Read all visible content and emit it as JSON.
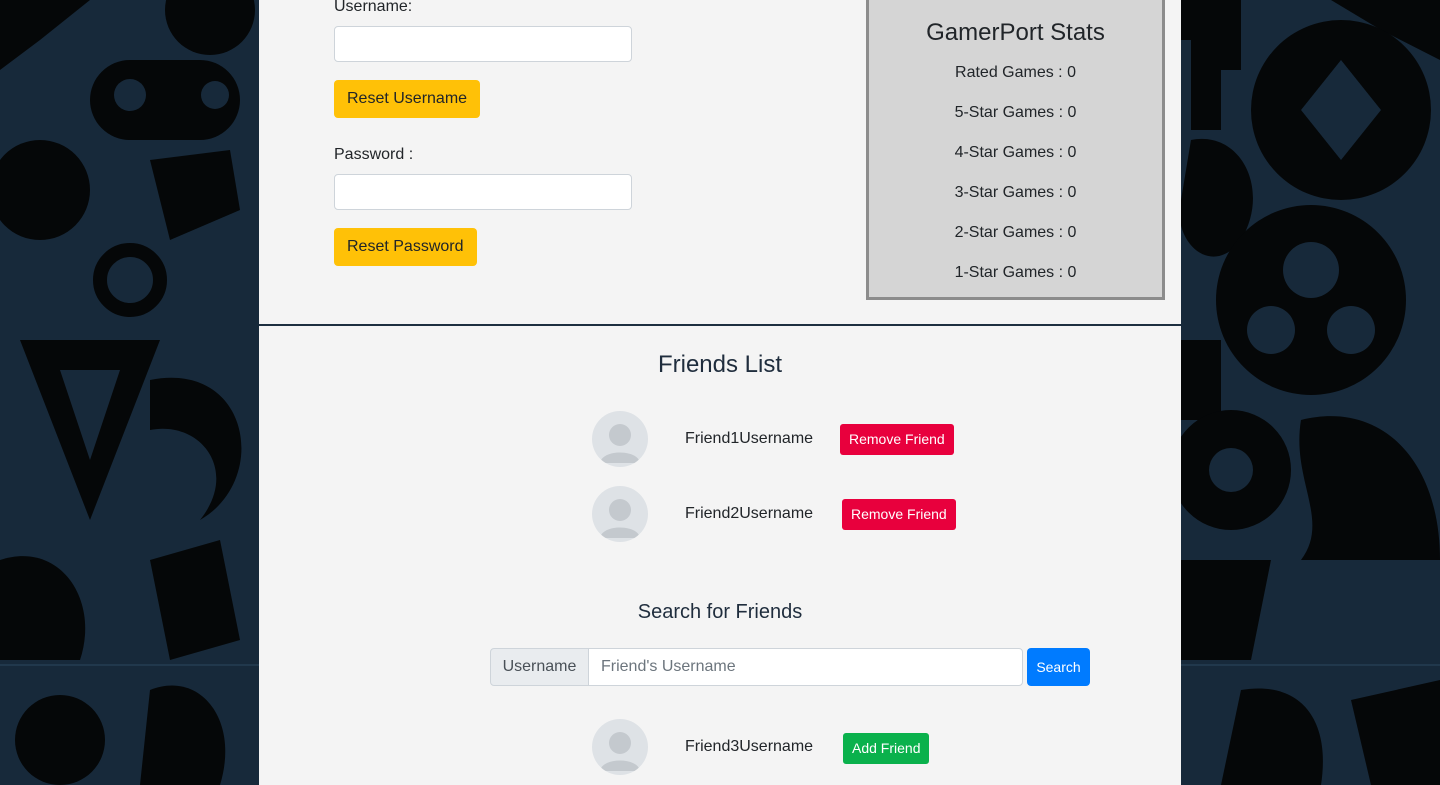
{
  "account": {
    "username_label": "Username:",
    "username_value": "",
    "reset_username_label": "Reset Username",
    "password_label": "Password :",
    "password_value": "",
    "reset_password_label": "Reset Password"
  },
  "stats": {
    "title": "GamerPort Stats",
    "lines": [
      "Rated Games : 0",
      "5-Star Games : 0",
      "4-Star Games : 0",
      "3-Star Games : 0",
      "2-Star Games : 0",
      "1-Star Games : 0"
    ]
  },
  "friends": {
    "title": "Friends List",
    "items": [
      {
        "name": "Friend1Username",
        "action": "Remove Friend"
      },
      {
        "name": "Friend2Username",
        "action": "Remove Friend"
      }
    ]
  },
  "search": {
    "title": "Search for Friends",
    "prefix": "Username",
    "placeholder": "Friend's Username",
    "button_label": "Search",
    "results": [
      {
        "name": "Friend3Username",
        "action": "Add Friend"
      }
    ]
  },
  "colors": {
    "background": "#17293a",
    "panel": "#f4f4f4",
    "warning": "#ffc107",
    "danger": "#e8003d",
    "success": "#0ab14c",
    "primary": "#007bff"
  }
}
